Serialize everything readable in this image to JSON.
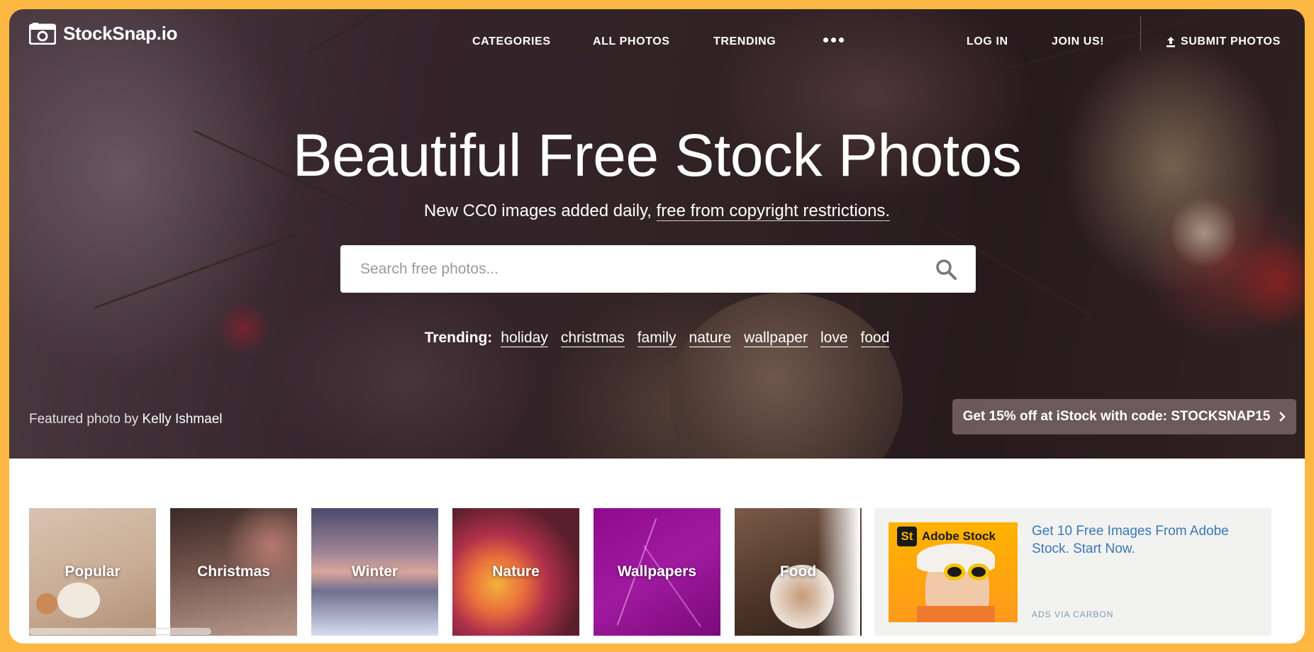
{
  "brand": {
    "name": "StockSnap.io"
  },
  "nav": {
    "categories": "CATEGORIES",
    "all_photos": "ALL PHOTOS",
    "trending": "TRENDING",
    "login": "LOG IN",
    "join": "JOIN US!",
    "submit": "SUBMIT PHOTOS"
  },
  "hero": {
    "title": "Beautiful Free Stock Photos",
    "subtitle_prefix": "New CC0 images added daily, ",
    "subtitle_link": "free from copyright restrictions."
  },
  "search": {
    "placeholder": "Search free photos..."
  },
  "trending": {
    "label": "Trending:",
    "tags": [
      "holiday",
      "christmas",
      "family",
      "nature",
      "wallpaper",
      "love",
      "food"
    ]
  },
  "featured": {
    "prefix": "Featured photo by ",
    "author": "Kelly Ishmael"
  },
  "promo": {
    "text": "Get 15% off at iStock with code: STOCKSNAP15"
  },
  "categories": [
    "Popular",
    "Christmas",
    "Winter",
    "Nature",
    "Wallpapers",
    "Food"
  ],
  "ad": {
    "logo_badge": "St",
    "logo_text": "Adobe Stock",
    "text": "Get 10 Free Images From Adobe Stock. Start Now.",
    "via": "ADS VIA CARBON"
  },
  "colors": {
    "frame": "#fdb844",
    "ad_link": "#3a78b6",
    "ad_bg": "#f2f2f0"
  },
  "icons": [
    "camera-icon",
    "upload-icon",
    "search-icon",
    "more-dots-icon",
    "chevron-right-icon"
  ]
}
